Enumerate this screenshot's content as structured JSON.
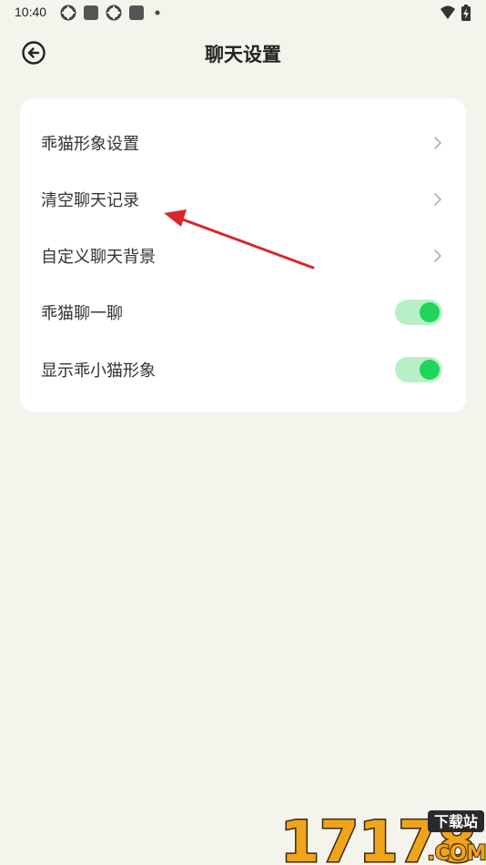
{
  "status_bar": {
    "time": "10:40"
  },
  "header": {
    "title": "聊天设置",
    "back_icon": "back-arrow-circle-icon"
  },
  "settings": {
    "items": [
      {
        "label": "乖猫形象设置",
        "control": "chevron"
      },
      {
        "label": "清空聊天记录",
        "control": "chevron"
      },
      {
        "label": "自定义聊天背景",
        "control": "chevron"
      },
      {
        "label": "乖猫聊一聊",
        "control": "toggle",
        "on": true
      },
      {
        "label": "显示乖小猫形象",
        "control": "toggle",
        "on": true
      }
    ]
  },
  "colors": {
    "background": "#f4f4ed",
    "card": "#ffffff",
    "toggle_track": "#b9efc6",
    "toggle_knob": "#21d45b",
    "annotation_arrow": "#d9262a"
  },
  "watermark": {
    "logo_number": "17178",
    "logo_suffix": ".COM",
    "badge": "下载站"
  }
}
